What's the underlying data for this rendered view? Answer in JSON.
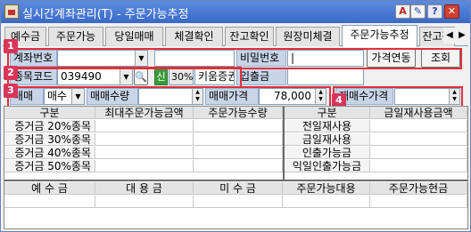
{
  "window": {
    "title": "실시간계좌관리(T) - 주문가능추정"
  },
  "titlebar_buttons": {
    "a": "A",
    "pen": "✎",
    "help": "?",
    "close": "✕"
  },
  "tabs": [
    {
      "label": "예수금"
    },
    {
      "label": "주문가능"
    },
    {
      "label": "당일매매"
    },
    {
      "label": "체결확인"
    },
    {
      "label": "잔고확인"
    },
    {
      "label": "원장미체결"
    },
    {
      "label": "주문가능추정"
    },
    {
      "label": "잔고작"
    }
  ],
  "tab_nav": {
    "prev": "◀",
    "next": "▶"
  },
  "badges": [
    "1",
    "2",
    "3",
    "4"
  ],
  "form": {
    "account_label": "계좌번호",
    "account_value": "",
    "password_label": "비밀번호",
    "password_value": "|",
    "link_price_button": "가격연동",
    "query_button": "조회",
    "stock_code_label": "종목코드",
    "stock_code_value": "039490",
    "credit_badge": "신",
    "margin_rate": "30%",
    "stock_name": "키움증권",
    "deposit_label": "입출금",
    "deposit_value": "",
    "trade_label": "매매",
    "trade_value": "매수",
    "qty_label": "매매수량",
    "qty_value": "",
    "price_label": "매매가격",
    "price_value": "78,000",
    "req_price_label": "재매수가격",
    "req_price_value": ""
  },
  "left_table": {
    "headers": [
      "구분",
      "최대주문가능금액",
      "주문가능수량"
    ],
    "rows": [
      [
        "증거금 20%종목",
        "",
        ""
      ],
      [
        "증거금 30%종목",
        "",
        ""
      ],
      [
        "증거금 40%종목",
        "",
        ""
      ],
      [
        "증거금 50%종목",
        "",
        ""
      ]
    ]
  },
  "right_table": {
    "headers": [
      "구분",
      "금일재사용금액"
    ],
    "rows": [
      [
        "전일재사용",
        ""
      ],
      [
        "금일재사용",
        ""
      ],
      [
        "인출가능금",
        ""
      ],
      [
        "익일인출가능금",
        ""
      ]
    ]
  },
  "bottom_table": {
    "headers": [
      "예 수 금",
      "대 용 금",
      "미 수 금",
      "주문가능대용",
      "주문가능현금"
    ],
    "values": [
      "",
      "",
      "",
      "",
      ""
    ]
  }
}
